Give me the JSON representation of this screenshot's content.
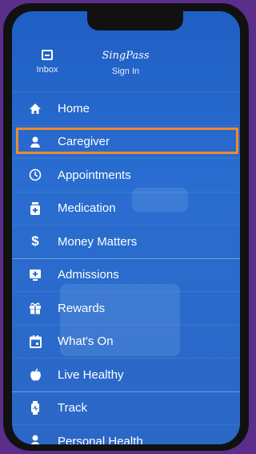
{
  "topbar": {
    "inbox_label": "Inbox",
    "singpass_logo": "SingPass",
    "signin_label": "Sign In"
  },
  "menu": {
    "items": [
      {
        "label": "Home",
        "icon": "home-icon"
      },
      {
        "label": "Caregiver",
        "icon": "caregiver-icon"
      },
      {
        "label": "Appointments",
        "icon": "clock-icon"
      },
      {
        "label": "Medication",
        "icon": "medication-icon"
      },
      {
        "label": "Money Matters",
        "icon": "dollar-icon"
      },
      {
        "label": "Admissions",
        "icon": "admissions-icon"
      },
      {
        "label": "Rewards",
        "icon": "gift-icon"
      },
      {
        "label": "What's On",
        "icon": "calendar-icon"
      },
      {
        "label": "Live Healthy",
        "icon": "apple-icon"
      },
      {
        "label": "Track",
        "icon": "watch-icon"
      },
      {
        "label": "Personal Health",
        "icon": "person-icon"
      }
    ]
  },
  "colors": {
    "highlight": "#f08a2c",
    "frame": "#5b2e8c",
    "screen": "#2a6dd0"
  }
}
